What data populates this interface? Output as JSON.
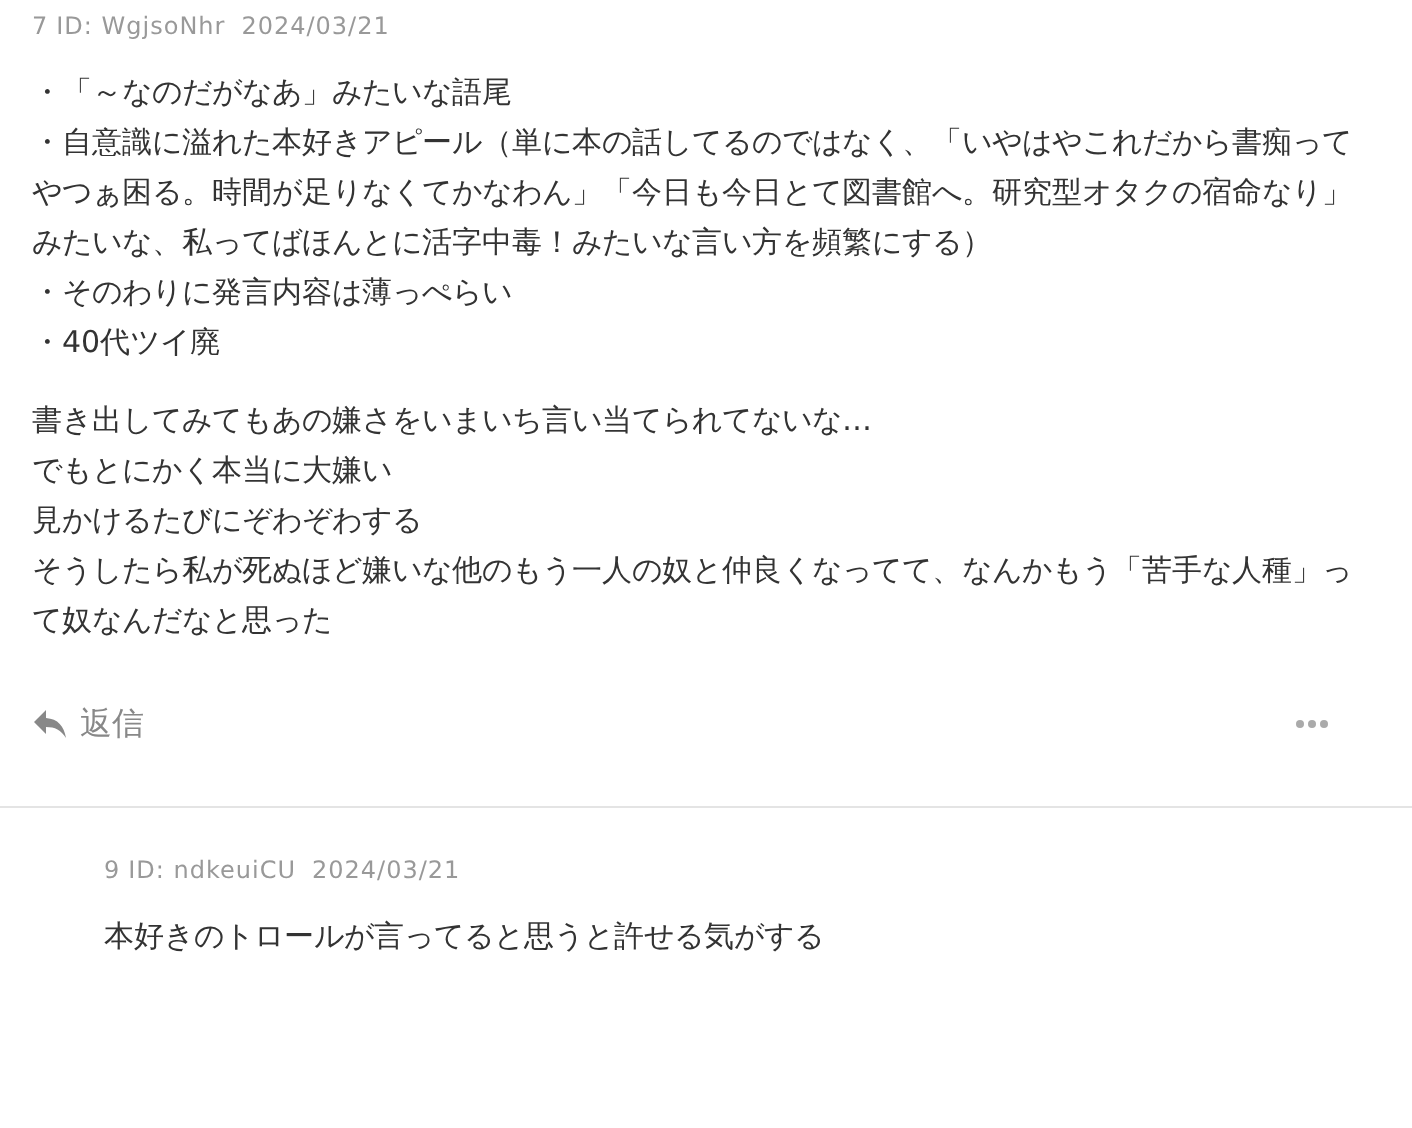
{
  "comments": [
    {
      "number": "7",
      "id": "ID: WgjsoNhr",
      "date": "2024/03/21",
      "nested": false,
      "paragraphs": [
        [
          "・「～なのだがなあ」みたいな語尾",
          "・自意識に溢れた本好きアピール（単に本の話してるのではなく、「いやはやこれだから書痴ってやつぁ困る。時間が足りなくてかなわん」「今日も今日とて図書館へ。研究型オタクの宿命なり」みたいな、私ってばほんとに活字中毒！みたいな言い方を頻繁にする）",
          "・そのわりに発言内容は薄っぺらい",
          "・40代ツイ廃"
        ],
        [
          "書き出してみてもあの嫌さをいまいち言い当てられてないな…",
          "でもとにかく本当に大嫌い",
          "見かけるたびにぞわぞわする",
          "そうしたら私が死ぬほど嫌いな他のもう一人の奴と仲良くなってて、なんかもう「苦手な人種」って奴なんだなと思った"
        ]
      ],
      "reply": "返信"
    },
    {
      "number": "9",
      "id": "ID: ndkeuiCU",
      "date": "2024/03/21",
      "nested": true,
      "paragraphs": [
        [
          "本好きのトロールが言ってると思うと許せる気がする"
        ]
      ]
    }
  ]
}
